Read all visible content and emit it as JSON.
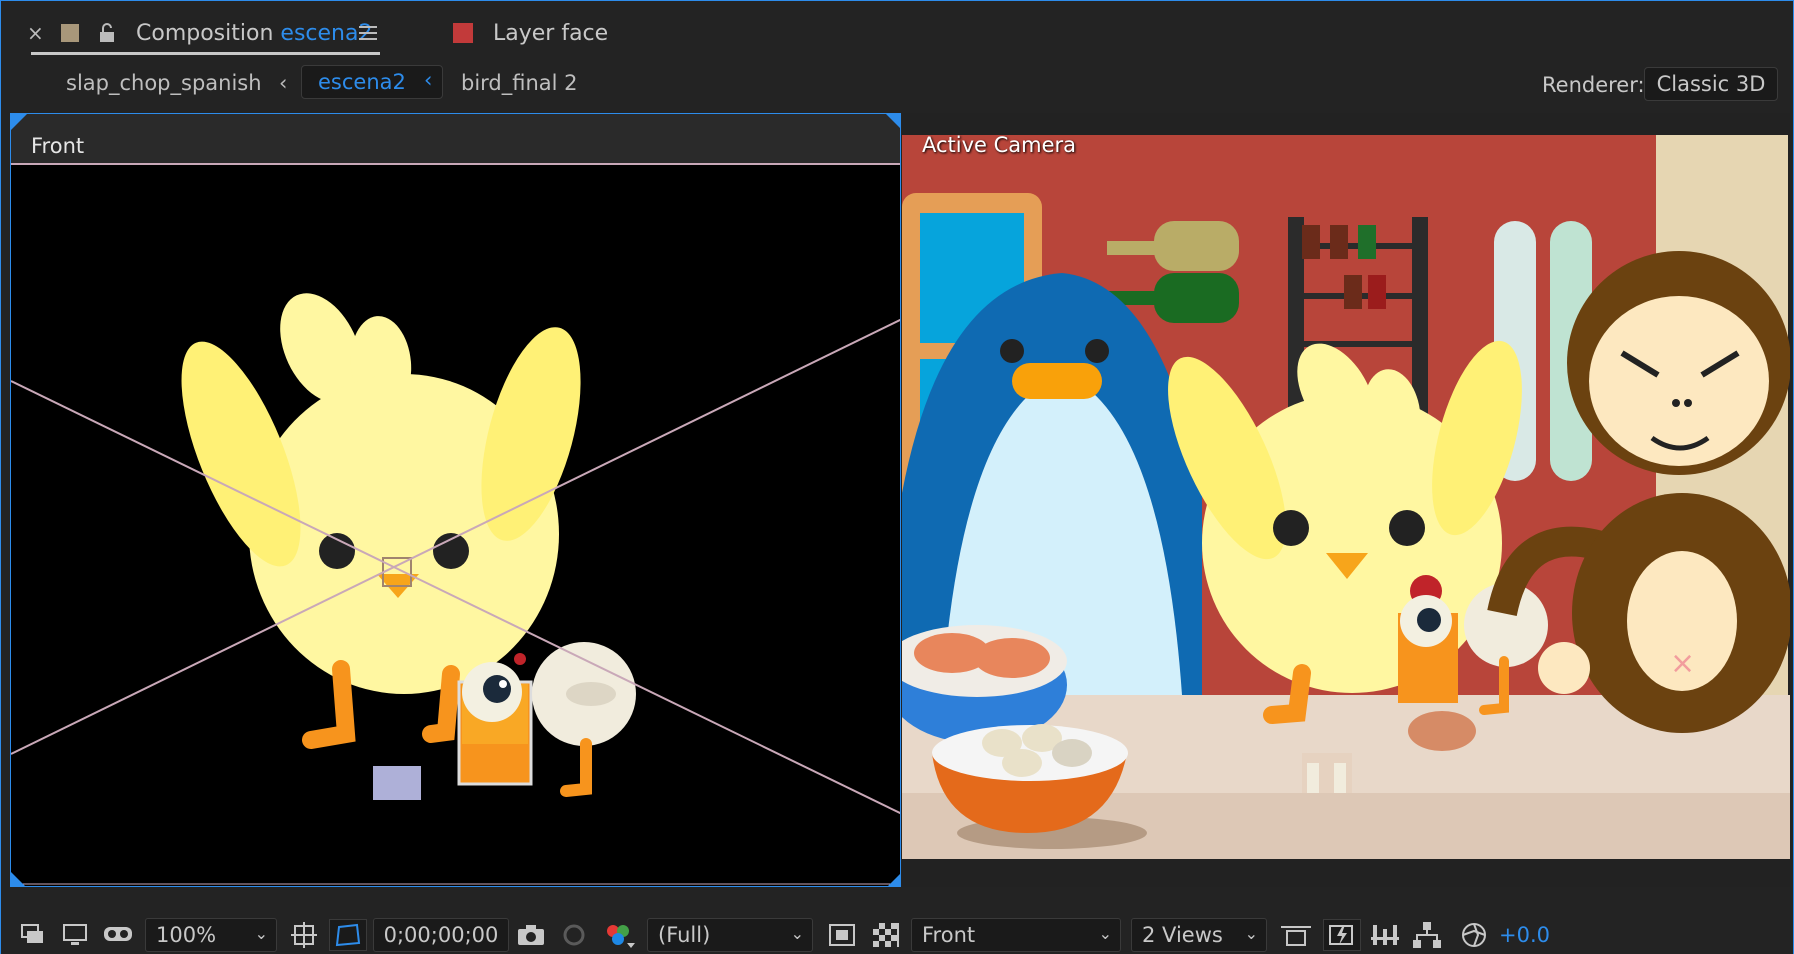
{
  "tabs": {
    "composition_prefix": "Composition",
    "composition_name": "escena2",
    "layer_tab": "Layer face"
  },
  "breadcrumb": {
    "items": [
      "slap_chop_spanish",
      "escena2",
      "bird_final 2"
    ]
  },
  "renderer": {
    "label": "Renderer:",
    "value": "Classic 3D"
  },
  "views": {
    "left_label": "Front",
    "right_label": "Active Camera"
  },
  "toolbar": {
    "zoom": "100%",
    "timecode": "0;00;00;00",
    "resolution": "(Full)",
    "view": "Front",
    "layout": "2 Views",
    "exposure": "+0.0"
  },
  "colors": {
    "accent": "#2d8ceb",
    "kitchen_wall": "#b8453a",
    "counter": "#e8d8c9",
    "chick": "#fff7a1",
    "penguin": "#0f6ab2",
    "monkey": "#6b4210"
  }
}
